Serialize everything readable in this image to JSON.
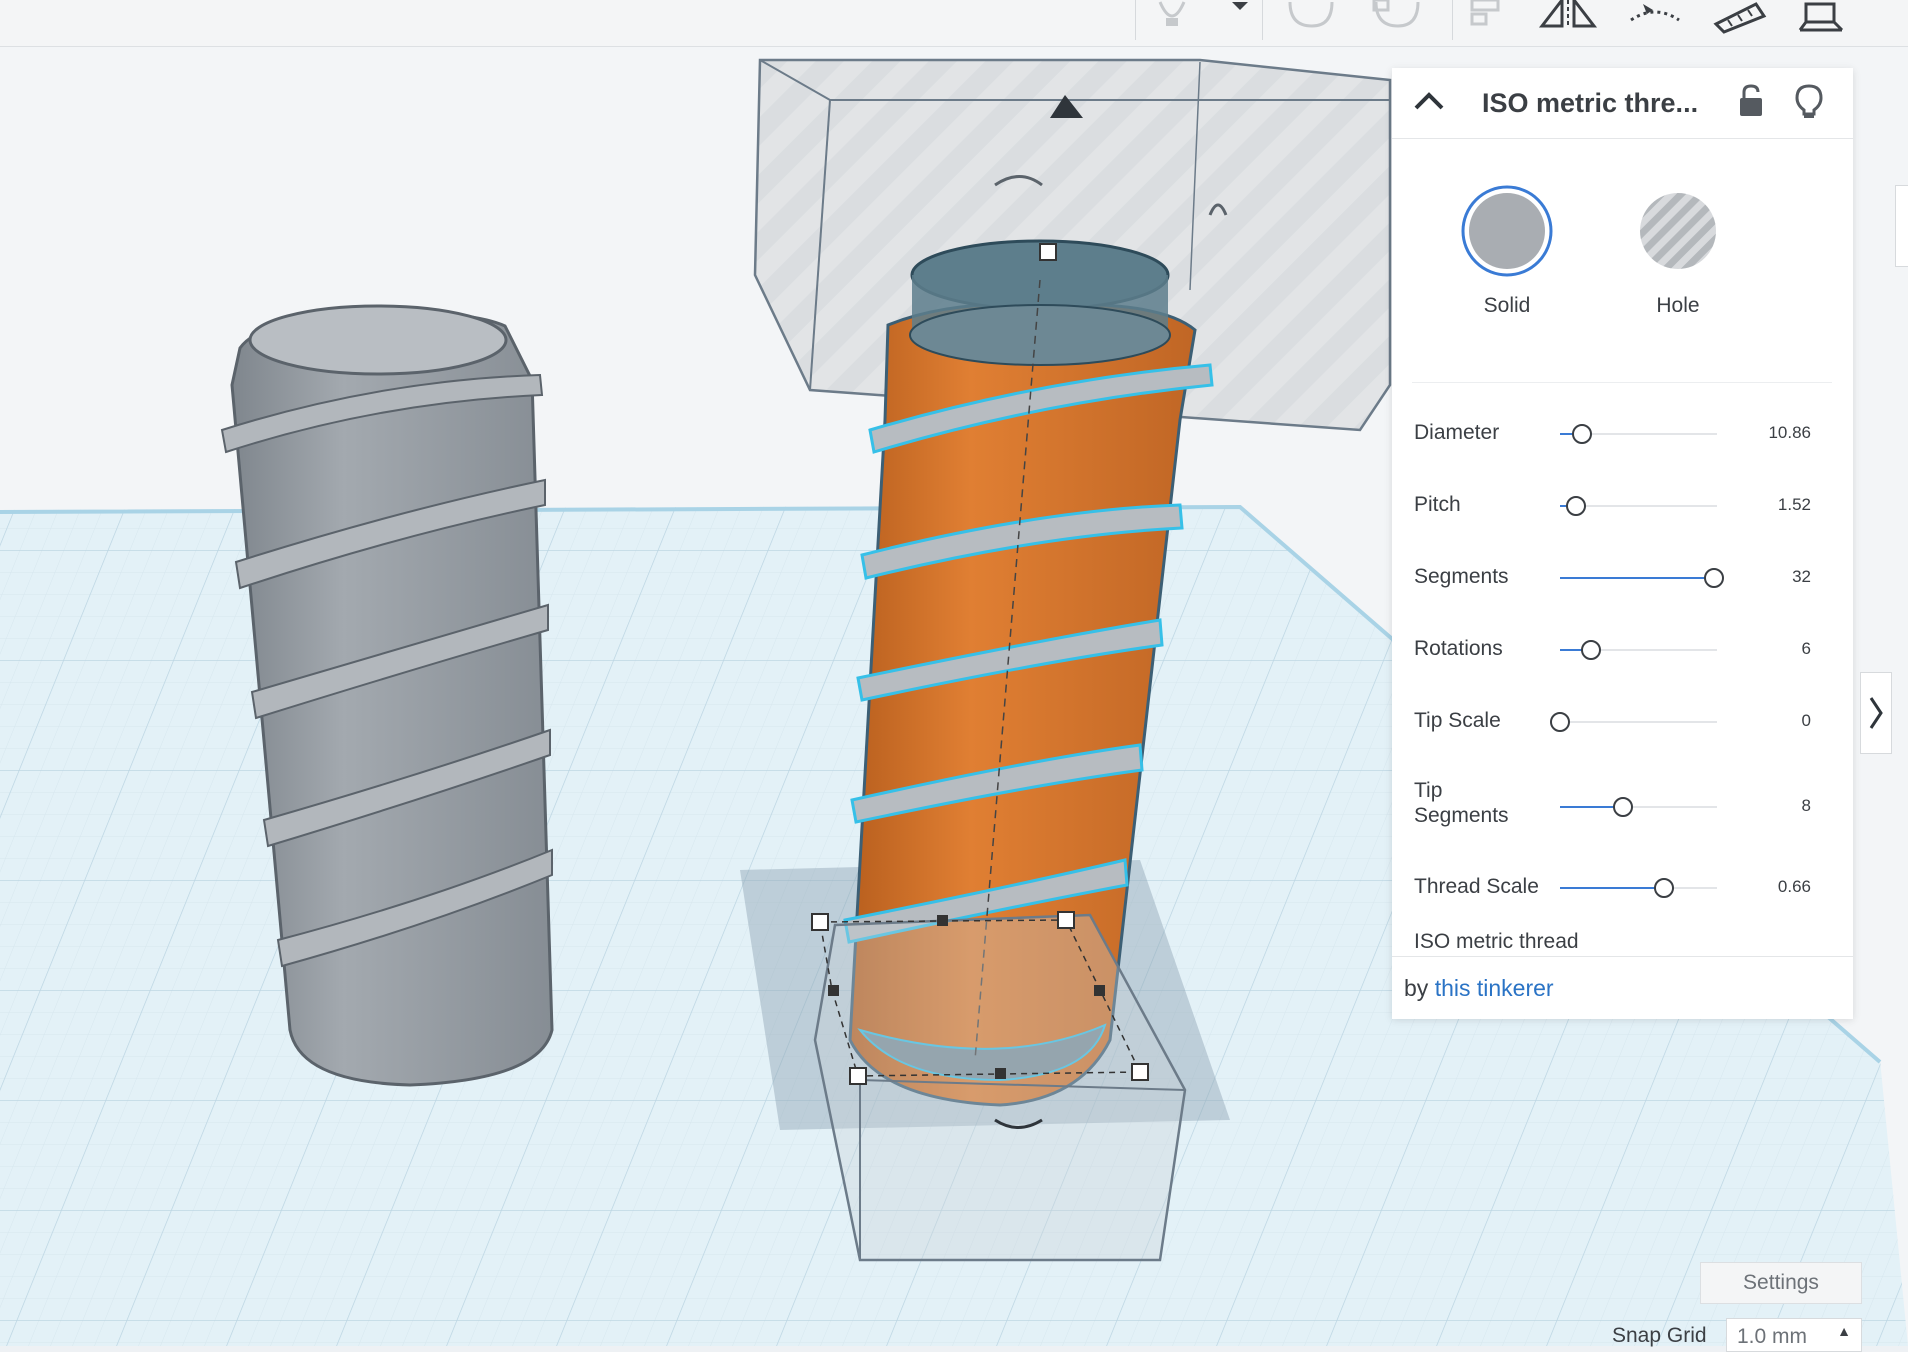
{
  "toolbar": {
    "icons": [
      "lightbulb-icon",
      "chevron-down-icon",
      "group-icon",
      "ungroup-icon",
      "align-icon",
      "mirror-icon",
      "cruise-icon",
      "ruler-icon",
      "workplane-icon"
    ]
  },
  "panel": {
    "title": "ISO metric thre...",
    "modes": [
      {
        "label": "Solid",
        "selected": true
      },
      {
        "label": "Hole",
        "selected": false
      }
    ],
    "params": [
      {
        "label": "Diameter",
        "value": "10.86",
        "level": 0.14
      },
      {
        "label": "Pitch",
        "value": "1.52",
        "level": 0.1
      },
      {
        "label": "Segments",
        "value": "32",
        "level": 0.98
      },
      {
        "label": "Rotations",
        "value": "6",
        "level": 0.2
      },
      {
        "label": "Tip Scale",
        "value": "0",
        "level": 0.0
      },
      {
        "label": "Tip\nSegments",
        "value": "8",
        "level": 0.4
      },
      {
        "label": "Thread Scale",
        "value": "0.66",
        "level": 0.66
      }
    ],
    "shape_name": "ISO metric thread",
    "footer": {
      "by": "by",
      "author": "this tinkerer"
    }
  },
  "bottom": {
    "settings_label": "Settings",
    "snap_label": "Snap Grid",
    "snap_value": "1.0 mm"
  },
  "colors": {
    "accent": "#3a7bd5",
    "selected_shape": "#d9762c",
    "grey_shape": "#9aa1a8",
    "grid": "#d7e9f1"
  }
}
